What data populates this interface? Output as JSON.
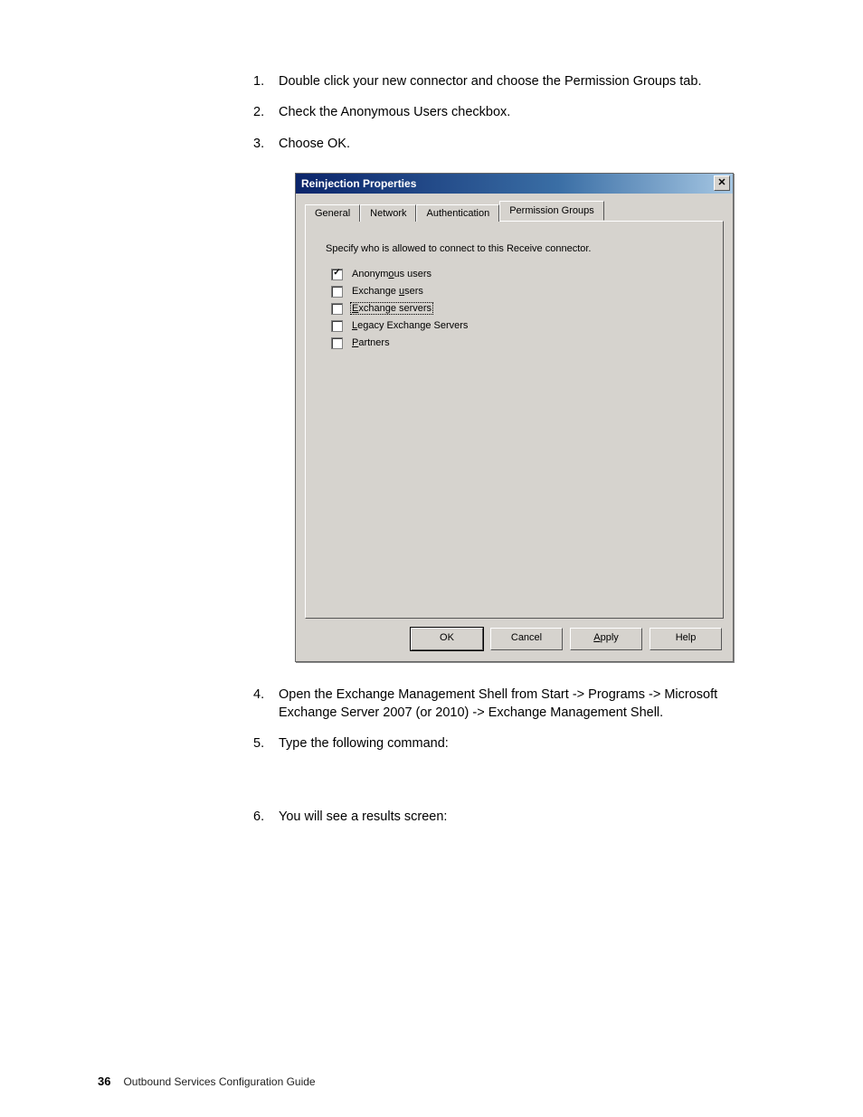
{
  "steps": {
    "s1": {
      "num": "1.",
      "text": "Double click your new connector and choose the Permission Groups tab."
    },
    "s2": {
      "num": "2.",
      "text": "Check the Anonymous Users checkbox."
    },
    "s3": {
      "num": "3.",
      "text": "Choose OK."
    },
    "s4": {
      "num": "4.",
      "text": "Open the Exchange Management Shell from Start -> Programs -> Microsoft Exchange Server 2007 (or 2010) -> Exchange Management Shell."
    },
    "s5": {
      "num": "5.",
      "text": "Type the following command:"
    },
    "s6": {
      "num": "6.",
      "text": "You will see a results screen:"
    }
  },
  "dialog": {
    "title": "Reinjection Properties",
    "close_glyph": "✕",
    "tabs": {
      "general": "General",
      "network": "Network",
      "auth": "Authentication",
      "perm": "Permission Groups"
    },
    "instruction": "Specify who is allowed to connect to this Receive connector.",
    "checks": {
      "anon": {
        "pre": "Anonym",
        "ul": "o",
        "post": "us users",
        "checked": true
      },
      "exusers": {
        "pre": "Exchange ",
        "ul": "u",
        "post": "sers",
        "checked": false
      },
      "exserv": {
        "pre": "",
        "ul": "E",
        "post": "xchange servers",
        "checked": false,
        "focused": true
      },
      "legacy": {
        "pre": "",
        "ul": "L",
        "post": "egacy Exchange Servers",
        "checked": false
      },
      "partners": {
        "pre": "",
        "ul": "P",
        "post": "artners",
        "checked": false
      }
    },
    "buttons": {
      "ok": "OK",
      "cancel": "Cancel",
      "apply_pre": "",
      "apply_ul": "A",
      "apply_post": "pply",
      "help": "Help"
    }
  },
  "footer": {
    "page": "36",
    "doc": "Outbound Services Configuration Guide"
  }
}
